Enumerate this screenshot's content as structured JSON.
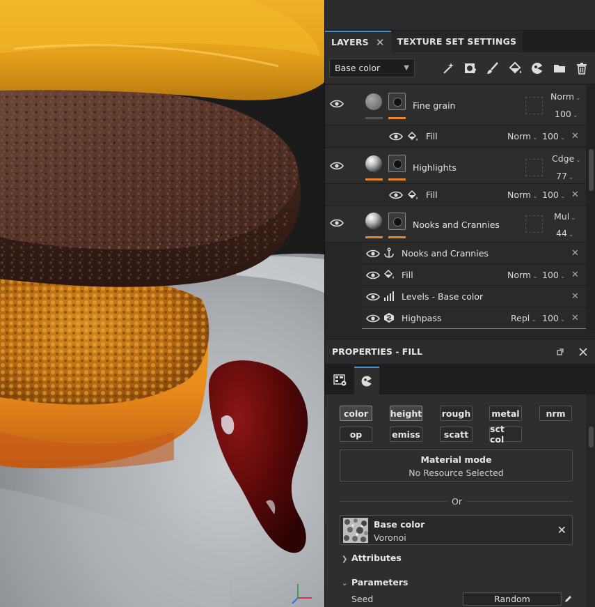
{
  "panel": {
    "tabs": [
      {
        "label": "LAYERS",
        "close": "✕"
      },
      {
        "label": "TEXTURE SET SETTINGS"
      }
    ],
    "channel_dropdown": {
      "value": "Base color",
      "chevron": "⌄"
    },
    "tool_icons": [
      "magic-wand-icon",
      "add-mask-icon",
      "paint-brush-icon",
      "fill-bucket-icon",
      "smart-material-icon",
      "folder-icon",
      "trash-icon"
    ]
  },
  "layers": [
    {
      "name": "Fine grain",
      "blend": "Norm",
      "opacity": "100",
      "thumb": "gray-sphere",
      "sub": {
        "name": "Fill",
        "blend": "Norm",
        "opacity": "100",
        "close": "✕"
      }
    },
    {
      "name": "Highlights",
      "blend": "Cdge",
      "opacity": "77",
      "thumb": "shaded-sphere",
      "sub": {
        "name": "Fill",
        "blend": "Norm",
        "opacity": "100",
        "close": "✕"
      }
    },
    {
      "name": "Nooks and Crannies",
      "blend": "Mul",
      "opacity": "44",
      "thumb": "shaded-sphere"
    }
  ],
  "effects": [
    {
      "name": "Nooks and Crannies",
      "icon": "anchor-icon",
      "close": "✕"
    },
    {
      "name": "Fill",
      "icon": "fill-bucket-icon",
      "blend": "Norm",
      "opacity": "100",
      "close": "✕"
    },
    {
      "name": "Levels - Base color",
      "icon": "levels-icon",
      "close": "✕"
    },
    {
      "name": "Highpass",
      "icon": "filter-icon",
      "blend": "Repl",
      "opacity": "100",
      "close": "✕"
    }
  ],
  "properties": {
    "title": "PROPERTIES - FILL",
    "channels_row1": [
      "color",
      "height",
      "rough",
      "metal",
      "nrm"
    ],
    "channels_row2": [
      "op",
      "emiss",
      "scatt",
      "sct col"
    ],
    "material_mode": {
      "title": "Material mode",
      "value": "No Resource Selected"
    },
    "or_label": "Or",
    "resource": {
      "title": "Base color",
      "value": "Voronoi",
      "close": "✕"
    },
    "attributes_label": "Attributes",
    "parameters_label": "Parameters",
    "seed_label": "Seed",
    "random_button": "Random"
  },
  "colors": {
    "accent": "#3b8fd9",
    "layer_bar": "#e8842d"
  }
}
